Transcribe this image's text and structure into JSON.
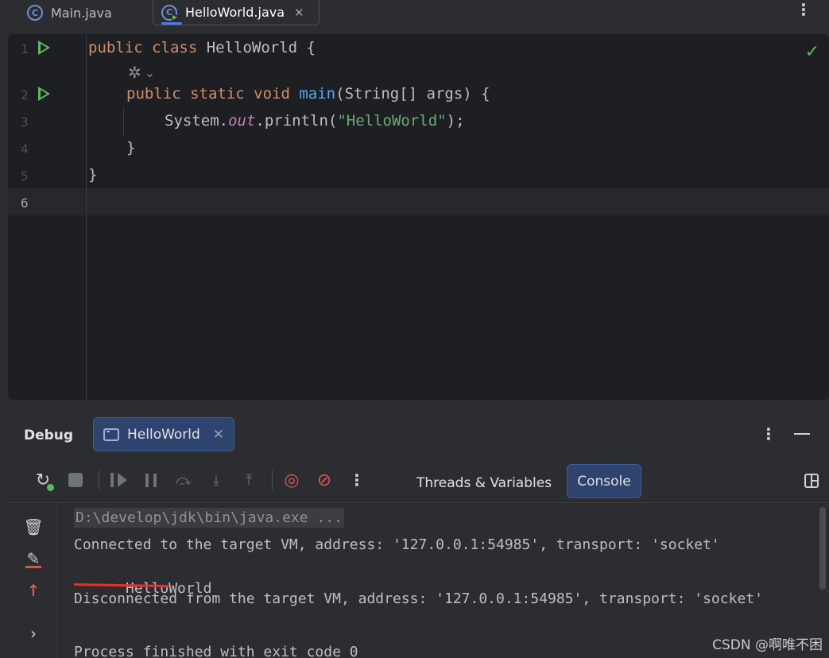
{
  "tabs": [
    {
      "label": "Main.java",
      "icon": "class-icon"
    },
    {
      "label": "HelloWorld.java",
      "icon": "runnable-class-icon",
      "active": true
    }
  ],
  "editor": {
    "line_numbers": [
      "1",
      "2",
      "3",
      "4",
      "5",
      "6"
    ],
    "code": {
      "l1_kw": "public class",
      "l1_rest": " HelloWorld {",
      "l2_kw": "public static void",
      "l2_fn": "main",
      "l2_rest": "(String[] args) {",
      "l3_a": "System.",
      "l3_field": "out",
      "l3_b": ".println(",
      "l3_str": "\"HelloWorld\"",
      "l3_c": ");",
      "l4": "}",
      "l5": "}"
    },
    "inlay_icon": "ai-gem-icon",
    "status_icon": "check-icon"
  },
  "debug": {
    "title": "Debug",
    "session_tab": "HelloWorld",
    "tabs": {
      "threads": "Threads & Variables",
      "console": "Console"
    },
    "toolbar_icons": [
      "rerun-debug-icon",
      "stop-icon",
      "resume-icon",
      "pause-icon",
      "step-over-icon",
      "step-into-icon",
      "step-out-icon",
      "view-breakpoints-icon",
      "mute-breakpoints-icon",
      "more-icon"
    ],
    "console_lines": {
      "cmd": "D:\\develop\\jdk\\bin\\java.exe ...",
      "connected": "Connected to the target VM, address: '127.0.0.1:54985', transport: 'socket'",
      "output": "HelloWorld",
      "disconnected": "Disconnected from the target VM, address: '127.0.0.1:54985', transport: 'socket'",
      "finished": "Process finished with exit code 0"
    }
  },
  "watermark": "CSDN @啊唯不困",
  "colors": {
    "accent": "#2e436e",
    "run_green": "#5fb865",
    "error_red": "#e5504f"
  }
}
